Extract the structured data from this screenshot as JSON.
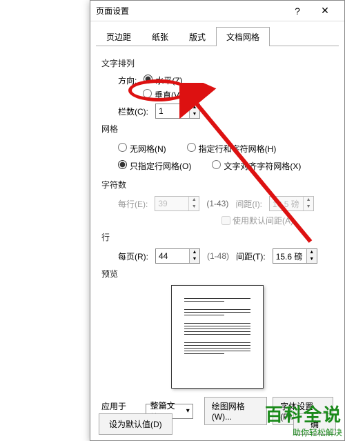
{
  "dialog": {
    "title": "页面设置",
    "help": "?",
    "close": "✕"
  },
  "tabs": {
    "t1": "页边距",
    "t2": "纸张",
    "t3": "版式",
    "t4": "文档网格"
  },
  "text_flow": {
    "section": "文字排列",
    "direction_label": "方向:",
    "horizontal": "水平(Z)",
    "vertical": "垂直(V)",
    "columns_label": "栏数(C):",
    "columns_value": "1"
  },
  "grid": {
    "section": "网格",
    "none": "无网格(N)",
    "specify_chars": "指定行和字符网格(H)",
    "lines_only": "只指定行网格(O)",
    "align_chars": "文字对齐字符网格(X)"
  },
  "chars": {
    "section": "字符数",
    "per_line": "每行(E):",
    "per_line_value": "39",
    "range1": "(1-43)",
    "spacing": "间距(I):",
    "spacing_value": "10.5 磅",
    "default_spacing": "使用默认间距(A)"
  },
  "lines": {
    "section": "行",
    "per_page": "每页(R):",
    "per_page_value": "44",
    "range": "(1-48)",
    "spacing": "间距(T):",
    "spacing_value": "15.6 磅"
  },
  "preview": {
    "section": "预览"
  },
  "apply": {
    "label": "应用于(Y):",
    "value": "整篇文档",
    "draw_grid": "绘图网格(W)...",
    "font_settings": "字体设置(F)..."
  },
  "footer": {
    "default": "设为默认值(D)",
    "ok": "确"
  },
  "watermark": {
    "big": "百科全说",
    "small": "助你轻松解决"
  }
}
